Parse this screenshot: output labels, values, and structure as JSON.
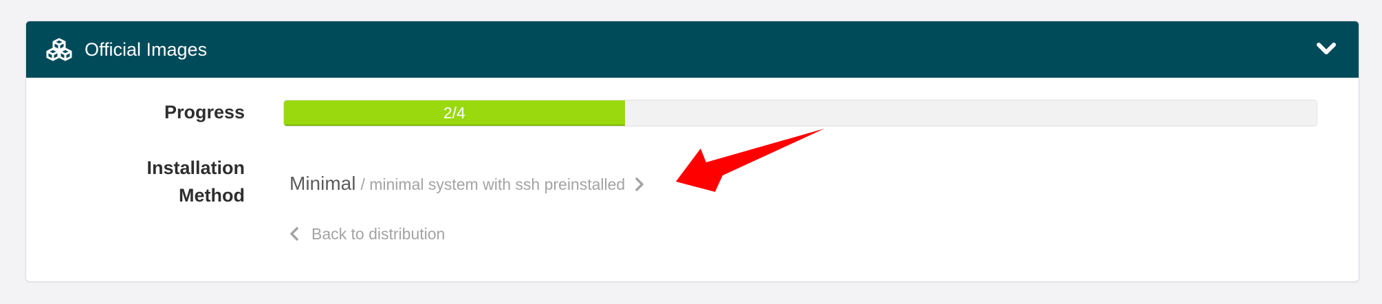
{
  "panel": {
    "title": "Official Images",
    "header_icon": "cubes-icon",
    "collapse_icon": "chevron-down-icon",
    "header_color": "#004b5a"
  },
  "progress": {
    "label": "Progress",
    "text": "2/4",
    "fraction": 0.33,
    "fill_color": "#9ad90e"
  },
  "installation_method": {
    "label_line1": "Installation",
    "label_line2": "Method",
    "name": "Minimal",
    "description": "/ minimal system with ssh preinstalled",
    "arrow_icon": "chevron-right-icon"
  },
  "back_link": {
    "text": "Back to distribution",
    "icon": "chevron-left-icon"
  },
  "annotation": {
    "icon": "red-pointer-arrow",
    "color": "#ff0000"
  }
}
